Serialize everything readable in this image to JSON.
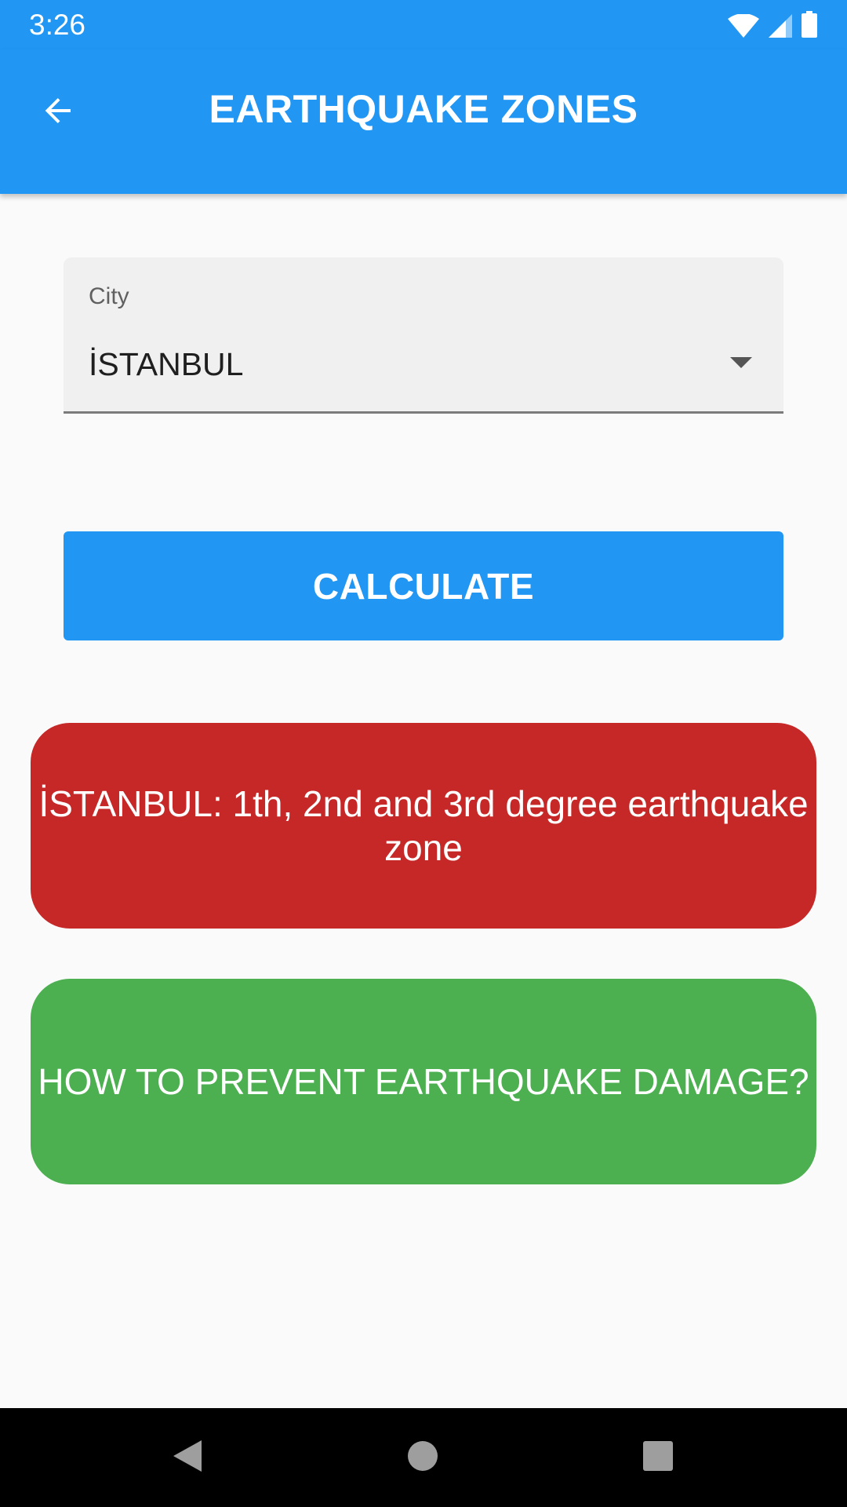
{
  "status_bar": {
    "time": "3:26",
    "icons": [
      "wifi-icon",
      "signal-icon",
      "battery-icon"
    ]
  },
  "app_bar": {
    "back_icon": "arrow-left-icon",
    "title": "EARTHQUAKE ZONES"
  },
  "form": {
    "city_label": "City",
    "city_value": "İSTANBUL",
    "dropdown_icon": "caret-down-icon"
  },
  "actions": {
    "calculate_label": "CALCULATE",
    "prevent_label": "HOW TO PREVENT EARTHQUAKE DAMAGE?"
  },
  "result": {
    "text": "İSTANBUL: 1th, 2nd and 3rd degree earthquake zone"
  },
  "nav_bar": {
    "buttons": [
      "back-triangle-icon",
      "home-circle-icon",
      "recents-square-icon"
    ]
  },
  "colors": {
    "primary": "#2196f3",
    "result_red": "#c62828",
    "action_green": "#4caf50",
    "background": "#fafafa",
    "field_fill": "#f0f0f0"
  }
}
